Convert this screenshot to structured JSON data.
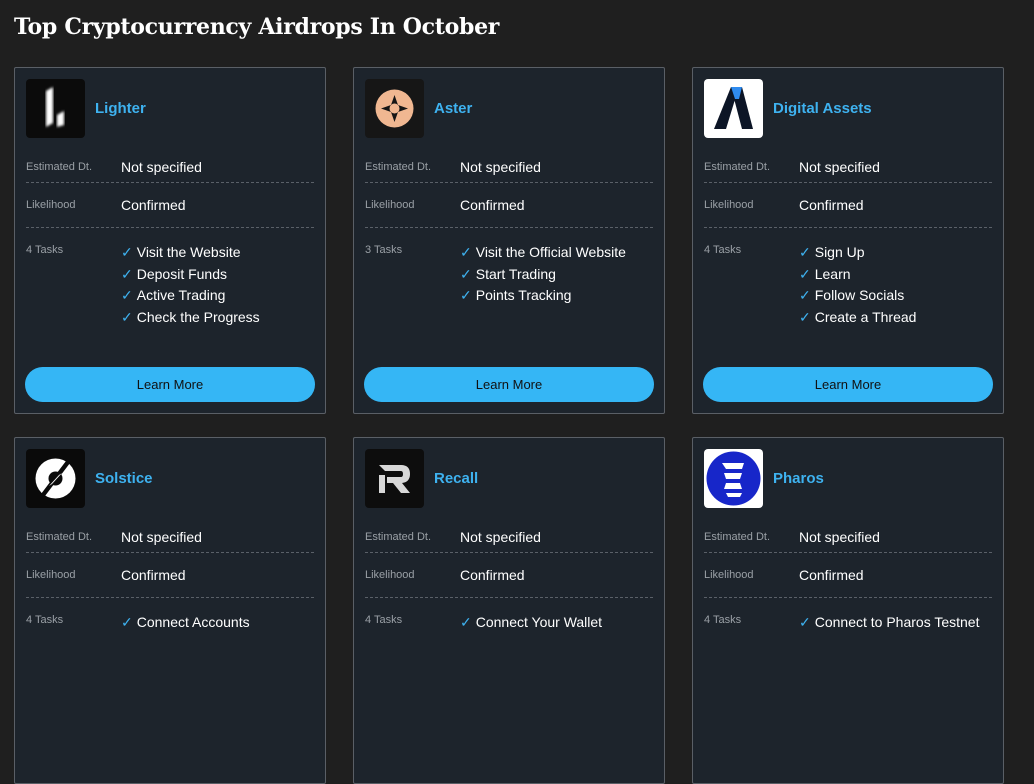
{
  "page": {
    "title": "Top Cryptocurrency Airdrops In October"
  },
  "labels": {
    "estimated": "Estimated Dt.",
    "likelihood": "Likelihood",
    "learn_more": "Learn More"
  },
  "cards": [
    {
      "name": "Lighter",
      "logo_icon": "lighter-logo-icon",
      "estimated": "Not specified",
      "likelihood": "Confirmed",
      "tasks_label": "4 Tasks",
      "tasks": [
        "Visit the Website",
        "Deposit Funds",
        "Active Trading",
        "Check the Progress"
      ]
    },
    {
      "name": "Aster",
      "logo_icon": "aster-logo-icon",
      "estimated": "Not specified",
      "likelihood": "Confirmed",
      "tasks_label": "3 Tasks",
      "tasks": [
        "Visit the Official Website",
        "Start Trading",
        "Points Tracking"
      ]
    },
    {
      "name": "Digital Assets",
      "logo_icon": "digital-assets-logo-icon",
      "estimated": "Not specified",
      "likelihood": "Confirmed",
      "tasks_label": "4 Tasks",
      "tasks": [
        "Sign Up",
        "Learn",
        "Follow Socials",
        "Create a Thread"
      ]
    },
    {
      "name": "Solstice",
      "logo_icon": "solstice-logo-icon",
      "estimated": "Not specified",
      "likelihood": "Confirmed",
      "tasks_label": "4 Tasks",
      "tasks": [
        "Connect Accounts"
      ]
    },
    {
      "name": "Recall",
      "logo_icon": "recall-logo-icon",
      "estimated": "Not specified",
      "likelihood": "Confirmed",
      "tasks_label": "4 Tasks",
      "tasks": [
        "Connect Your Wallet"
      ]
    },
    {
      "name": "Pharos",
      "logo_icon": "pharos-logo-icon",
      "estimated": "Not specified",
      "likelihood": "Confirmed",
      "tasks_label": "4 Tasks",
      "tasks": [
        "Connect to Pharos Testnet"
      ]
    }
  ],
  "colors": {
    "accent": "#3eb2f0",
    "button": "#35b6f5",
    "card_bg": "#1d242c",
    "page_bg": "#1f1f1f"
  }
}
